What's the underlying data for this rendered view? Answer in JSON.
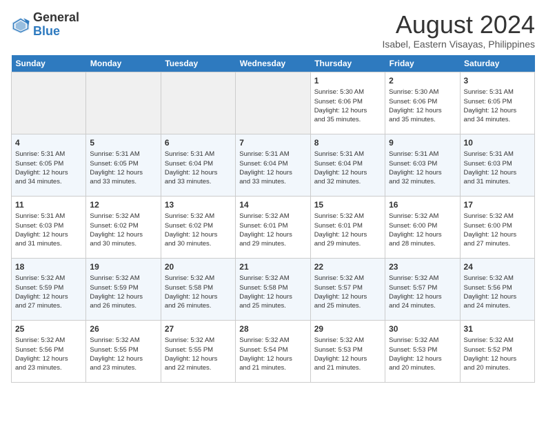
{
  "header": {
    "logo_line1": "General",
    "logo_line2": "Blue",
    "month": "August 2024",
    "location": "Isabel, Eastern Visayas, Philippines"
  },
  "days_of_week": [
    "Sunday",
    "Monday",
    "Tuesday",
    "Wednesday",
    "Thursday",
    "Friday",
    "Saturday"
  ],
  "weeks": [
    [
      {
        "day": "",
        "info": ""
      },
      {
        "day": "",
        "info": ""
      },
      {
        "day": "",
        "info": ""
      },
      {
        "day": "",
        "info": ""
      },
      {
        "day": "1",
        "info": "Sunrise: 5:30 AM\nSunset: 6:06 PM\nDaylight: 12 hours\nand 35 minutes."
      },
      {
        "day": "2",
        "info": "Sunrise: 5:30 AM\nSunset: 6:06 PM\nDaylight: 12 hours\nand 35 minutes."
      },
      {
        "day": "3",
        "info": "Sunrise: 5:31 AM\nSunset: 6:05 PM\nDaylight: 12 hours\nand 34 minutes."
      }
    ],
    [
      {
        "day": "4",
        "info": "Sunrise: 5:31 AM\nSunset: 6:05 PM\nDaylight: 12 hours\nand 34 minutes."
      },
      {
        "day": "5",
        "info": "Sunrise: 5:31 AM\nSunset: 6:05 PM\nDaylight: 12 hours\nand 33 minutes."
      },
      {
        "day": "6",
        "info": "Sunrise: 5:31 AM\nSunset: 6:04 PM\nDaylight: 12 hours\nand 33 minutes."
      },
      {
        "day": "7",
        "info": "Sunrise: 5:31 AM\nSunset: 6:04 PM\nDaylight: 12 hours\nand 33 minutes."
      },
      {
        "day": "8",
        "info": "Sunrise: 5:31 AM\nSunset: 6:04 PM\nDaylight: 12 hours\nand 32 minutes."
      },
      {
        "day": "9",
        "info": "Sunrise: 5:31 AM\nSunset: 6:03 PM\nDaylight: 12 hours\nand 32 minutes."
      },
      {
        "day": "10",
        "info": "Sunrise: 5:31 AM\nSunset: 6:03 PM\nDaylight: 12 hours\nand 31 minutes."
      }
    ],
    [
      {
        "day": "11",
        "info": "Sunrise: 5:31 AM\nSunset: 6:03 PM\nDaylight: 12 hours\nand 31 minutes."
      },
      {
        "day": "12",
        "info": "Sunrise: 5:32 AM\nSunset: 6:02 PM\nDaylight: 12 hours\nand 30 minutes."
      },
      {
        "day": "13",
        "info": "Sunrise: 5:32 AM\nSunset: 6:02 PM\nDaylight: 12 hours\nand 30 minutes."
      },
      {
        "day": "14",
        "info": "Sunrise: 5:32 AM\nSunset: 6:01 PM\nDaylight: 12 hours\nand 29 minutes."
      },
      {
        "day": "15",
        "info": "Sunrise: 5:32 AM\nSunset: 6:01 PM\nDaylight: 12 hours\nand 29 minutes."
      },
      {
        "day": "16",
        "info": "Sunrise: 5:32 AM\nSunset: 6:00 PM\nDaylight: 12 hours\nand 28 minutes."
      },
      {
        "day": "17",
        "info": "Sunrise: 5:32 AM\nSunset: 6:00 PM\nDaylight: 12 hours\nand 27 minutes."
      }
    ],
    [
      {
        "day": "18",
        "info": "Sunrise: 5:32 AM\nSunset: 5:59 PM\nDaylight: 12 hours\nand 27 minutes."
      },
      {
        "day": "19",
        "info": "Sunrise: 5:32 AM\nSunset: 5:59 PM\nDaylight: 12 hours\nand 26 minutes."
      },
      {
        "day": "20",
        "info": "Sunrise: 5:32 AM\nSunset: 5:58 PM\nDaylight: 12 hours\nand 26 minutes."
      },
      {
        "day": "21",
        "info": "Sunrise: 5:32 AM\nSunset: 5:58 PM\nDaylight: 12 hours\nand 25 minutes."
      },
      {
        "day": "22",
        "info": "Sunrise: 5:32 AM\nSunset: 5:57 PM\nDaylight: 12 hours\nand 25 minutes."
      },
      {
        "day": "23",
        "info": "Sunrise: 5:32 AM\nSunset: 5:57 PM\nDaylight: 12 hours\nand 24 minutes."
      },
      {
        "day": "24",
        "info": "Sunrise: 5:32 AM\nSunset: 5:56 PM\nDaylight: 12 hours\nand 24 minutes."
      }
    ],
    [
      {
        "day": "25",
        "info": "Sunrise: 5:32 AM\nSunset: 5:56 PM\nDaylight: 12 hours\nand 23 minutes."
      },
      {
        "day": "26",
        "info": "Sunrise: 5:32 AM\nSunset: 5:55 PM\nDaylight: 12 hours\nand 23 minutes."
      },
      {
        "day": "27",
        "info": "Sunrise: 5:32 AM\nSunset: 5:55 PM\nDaylight: 12 hours\nand 22 minutes."
      },
      {
        "day": "28",
        "info": "Sunrise: 5:32 AM\nSunset: 5:54 PM\nDaylight: 12 hours\nand 21 minutes."
      },
      {
        "day": "29",
        "info": "Sunrise: 5:32 AM\nSunset: 5:53 PM\nDaylight: 12 hours\nand 21 minutes."
      },
      {
        "day": "30",
        "info": "Sunrise: 5:32 AM\nSunset: 5:53 PM\nDaylight: 12 hours\nand 20 minutes."
      },
      {
        "day": "31",
        "info": "Sunrise: 5:32 AM\nSunset: 5:52 PM\nDaylight: 12 hours\nand 20 minutes."
      }
    ]
  ]
}
